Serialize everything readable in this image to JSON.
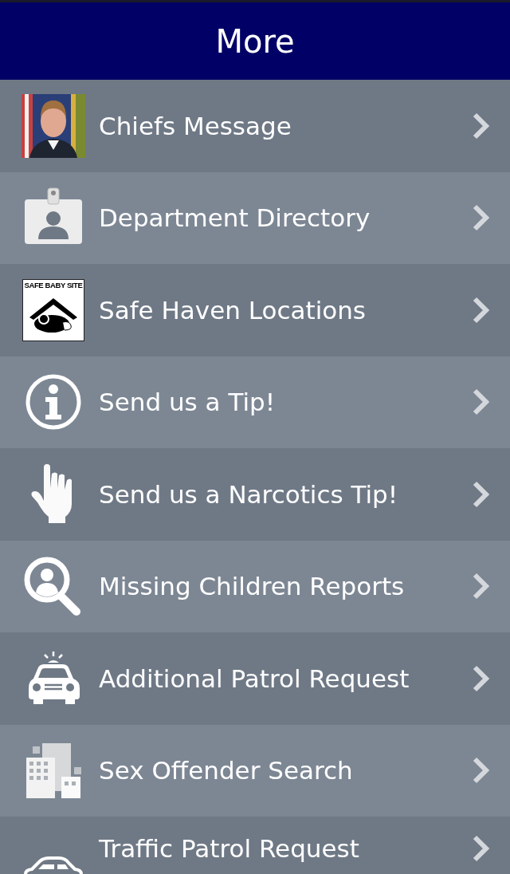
{
  "header": {
    "title": "More"
  },
  "items": [
    {
      "kind": "picture",
      "label": "Chiefs Message"
    },
    {
      "kind": "icon",
      "label": "Department Directory"
    },
    {
      "kind": "logo",
      "logo_text": "SAFE BABY SITE",
      "label": "Safe Haven Locations"
    },
    {
      "kind": "icon",
      "label": "Send us a Tip!"
    },
    {
      "kind": "icon",
      "label": "Send us a Narcotics Tip!"
    },
    {
      "kind": "icon",
      "label": "Missing Children Reports"
    },
    {
      "kind": "icon",
      "label": "Additional Patrol Request"
    },
    {
      "kind": "icon",
      "label": "Sex Offender Search"
    },
    {
      "kind": "icon",
      "label": "Traffic Patrol Request"
    }
  ]
}
